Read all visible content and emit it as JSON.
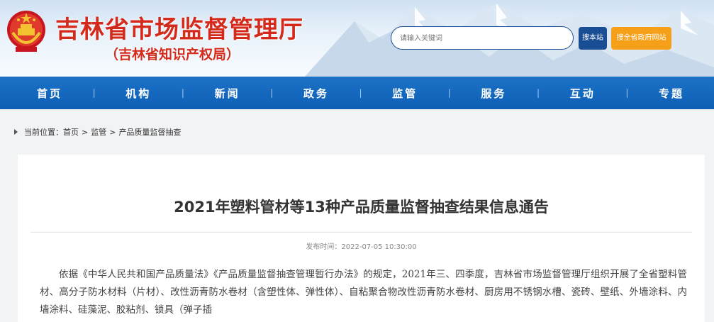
{
  "header": {
    "title": "吉林省市场监督管理厅",
    "subtitle": "（吉林省知识产权局）",
    "search_placeholder": "请输入关键词",
    "btn_site": "搜本站",
    "btn_all": "搜全省政府网站"
  },
  "nav": {
    "items": [
      "首页",
      "机构",
      "新闻",
      "政务",
      "监管",
      "服务",
      "互动",
      "专题"
    ],
    "separator": "|"
  },
  "breadcrumb": {
    "label": "当前位置：",
    "items": [
      "首页",
      "监管",
      "产品质量监督抽查"
    ],
    "sep": ">"
  },
  "article": {
    "title": "2021年塑料管材等13种产品质量监督抽查结果信息通告",
    "date": "发布时间：2022-07-05 10:30:00",
    "body": "依据《中华人民共和国产品质量法》《产品质量监督抽查管理暂行办法》的规定，2021年三、四季度，吉林省市场监督管理厅组织开展了全省塑料管材、高分子防水材料（片材）、改性沥青防水卷材（含塑性体、弹性体）、自粘聚合物改性沥青防水卷材、厨房用不锈钢水槽、瓷砖、壁纸、外墙涂料、内墙涂料、硅藻泥、胶粘剂、锁具（弹子插"
  },
  "colors": {
    "brand_red": "#d42a1c",
    "nav_blue": "#0e5fb5",
    "search_blue": "#1a4e94",
    "orange": "#f6a01a"
  }
}
